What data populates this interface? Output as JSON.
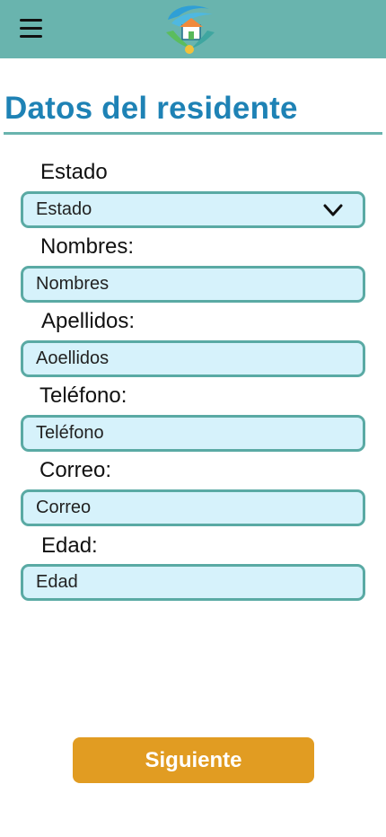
{
  "header": {
    "menu_icon": "hamburger-menu-icon",
    "logo_icon": "hands-house-logo-icon"
  },
  "page": {
    "title": "Datos del residente"
  },
  "form": {
    "estado": {
      "label": "Estado",
      "value": "Estado",
      "icon": "chevron-down-icon"
    },
    "nombres": {
      "label": "Nombres:",
      "placeholder": "Nombres"
    },
    "apellidos": {
      "label": "Apellidos:",
      "placeholder": "Aoellidos"
    },
    "telefono": {
      "label": "Teléfono:",
      "placeholder": "Teléfono"
    },
    "correo": {
      "label": "Correo:",
      "placeholder": "Correo"
    },
    "edad": {
      "label": "Edad:",
      "placeholder": "Edad"
    }
  },
  "actions": {
    "next_label": "Siguiente"
  },
  "colors": {
    "header_bg": "#69b4ae",
    "title": "#1e82b5",
    "field_bg": "#d6f2fb",
    "field_border": "#5aaaa4",
    "button": "#e19c22"
  }
}
